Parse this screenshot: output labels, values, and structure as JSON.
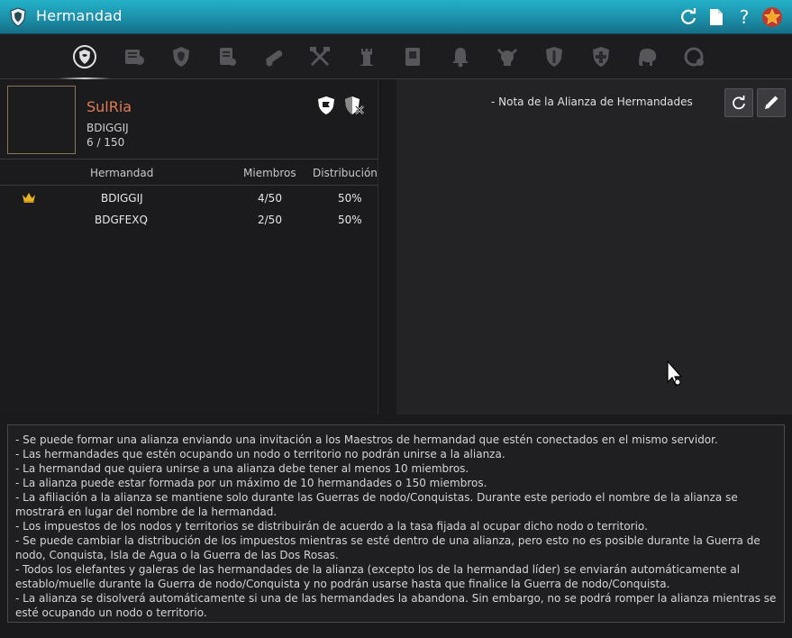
{
  "window": {
    "title": "Hermandad",
    "buttons": [
      "refresh-icon",
      "document-icon",
      "help-icon",
      "favorite-star-icon"
    ],
    "help_label": "?"
  },
  "tabs": [
    {
      "icon": "guild-emblem-icon",
      "active": false
    },
    {
      "icon": "guild-list-icon",
      "active": false
    },
    {
      "icon": "shield-icon",
      "active": false
    },
    {
      "icon": "scroll-icon",
      "active": false
    },
    {
      "icon": "cannon-icon",
      "active": false
    },
    {
      "icon": "crossed-axes-icon",
      "active": false
    },
    {
      "icon": "tower-icon",
      "active": false
    },
    {
      "icon": "quest-scroll-icon",
      "active": false
    },
    {
      "icon": "bell-icon",
      "active": false
    },
    {
      "icon": "skull-icon",
      "active": false
    },
    {
      "icon": "knight-shield-icon",
      "active": false
    },
    {
      "icon": "cross-shield-icon",
      "active": false
    },
    {
      "icon": "elephant-icon",
      "active": false
    },
    {
      "icon": "alliance-icon",
      "active": true
    }
  ],
  "alliance": {
    "name": "SulRia",
    "leader_guild": "BDIGGIJ",
    "member_count": "6 / 150",
    "name_color": "#e07a52"
  },
  "table": {
    "headers": {
      "guild": "Hermandad",
      "members": "Miembros",
      "distribution": "Distribución"
    },
    "rows": [
      {
        "leader": true,
        "guild": "BDIGGIJ",
        "members": "4/50",
        "distribution": "50%"
      },
      {
        "leader": false,
        "guild": "BDGFEXQ",
        "members": "2/50",
        "distribution": "50%"
      }
    ]
  },
  "note": {
    "title": "- Nota de la Alianza de Hermandades"
  },
  "info": [
    "- Se puede formar una alianza enviando una invitación a los Maestros de hermandad que estén conectados en el mismo servidor.",
    "- Las hermandades que estén ocupando un nodo o territorio no podrán unirse a la alianza.",
    "- La hermandad que quiera unirse a una alianza debe tener al menos 10 miembros.",
    "- La alianza puede estar formada por un máximo de 10 hermandades o 150 miembros.",
    "- La afiliación a la alianza se mantiene solo durante las Guerras de nodo/Conquistas. Durante este periodo el nombre de la alianza se mostrará en lugar del nombre de la hermandad.",
    "- Los impuestos de los nodos y territorios se distribuirán de acuerdo a la tasa fijada al ocupar dicho nodo o territorio.",
    "- Se puede cambiar la distribución de los impuestos mientras se esté dentro de una alianza, pero esto no es posible durante la Guerra de nodo, Conquista, Isla de Agua o la Guerra de las Dos Rosas.",
    "- Todos los elefantes y galeras de las hermandades de la alianza (excepto los de la hermandad líder) se enviarán automáticamente al establo/muelle durante la Guerra de nodo/Conquista y no podrán usarse hasta que finalice la Guerra de nodo/Conquista.",
    "- La alianza se disolverá automáticamente si una de las hermandades la abandona. Sin embargo, no se podrá romper la alianza mientras se esté ocupando un nodo o territorio."
  ]
}
